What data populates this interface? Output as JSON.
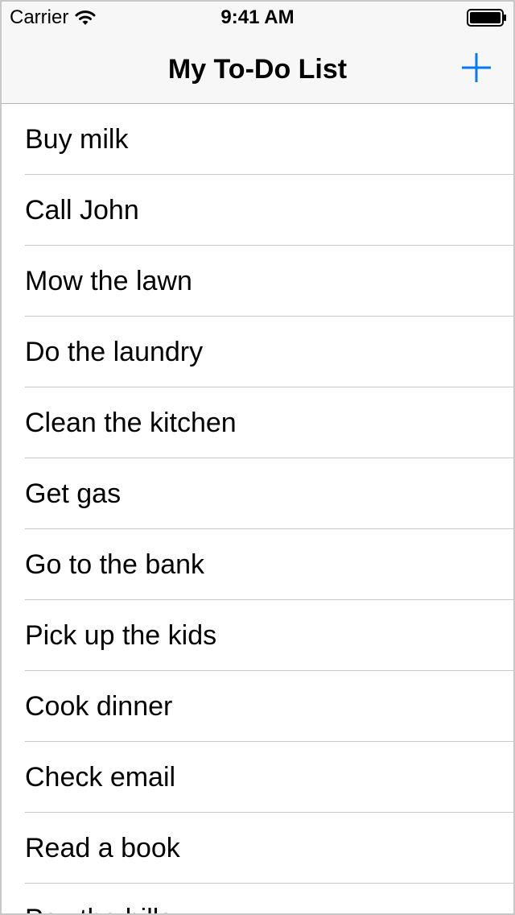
{
  "status_bar": {
    "carrier": "Carrier",
    "time": "9:41 AM",
    "wifi_icon": "wifi-icon",
    "battery_icon": "battery-icon"
  },
  "nav_bar": {
    "title": "My To-Do List",
    "add_icon": "plus-icon",
    "accent_color": "#007aff"
  },
  "todo_items": [
    "Buy milk",
    "Call John",
    "Mow the lawn",
    "Do the laundry",
    "Clean the kitchen",
    "Get gas",
    "Go to the bank",
    "Pick up the kids",
    "Cook dinner",
    "Check email",
    "Read a book",
    "Pay the bills"
  ]
}
